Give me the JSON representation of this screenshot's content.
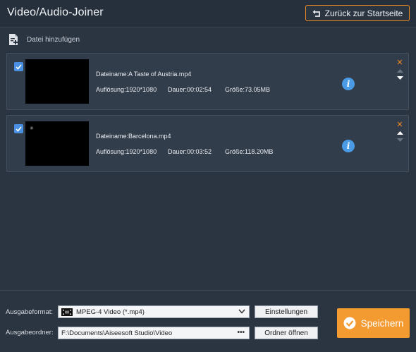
{
  "app": {
    "title": "Video/Audio-Joiner"
  },
  "header": {
    "back_label": "Zurück zur Startseite",
    "back_icon": "return-arrow-icon"
  },
  "toolbar": {
    "add_file_label": "Datei hinzufügen",
    "add_file_icon": "add-file-icon"
  },
  "items": [
    {
      "checked": true,
      "filename": "Dateiname:A Taste of Austria.mp4",
      "resolution": "Auflösung:1920*1080",
      "duration": "Dauer:00:02:54",
      "size": "Größe:73.05MB"
    },
    {
      "checked": true,
      "thumb_mark": "✳",
      "filename": "Dateiname:Barcelona.mp4",
      "resolution": "Auflösung:1920*1080",
      "duration": "Dauer:00:03:52",
      "size": "Größe:118.20MB"
    }
  ],
  "output": {
    "format_label": "Ausgabeformat:",
    "format_value": "MPEG-4 Video (*.mp4)",
    "settings_label": "Einstellungen",
    "folder_label": "Ausgabeordner:",
    "folder_value": "F:\\Documents\\Aiseesoft Studio\\Video",
    "browse_label": "•••",
    "open_folder_label": "Ordner öffnen",
    "save_label": "Speichern"
  },
  "colors": {
    "background": "#2b3542",
    "accent": "#f39a31",
    "checkbox": "#4a90e2",
    "info": "#4a9be6"
  }
}
